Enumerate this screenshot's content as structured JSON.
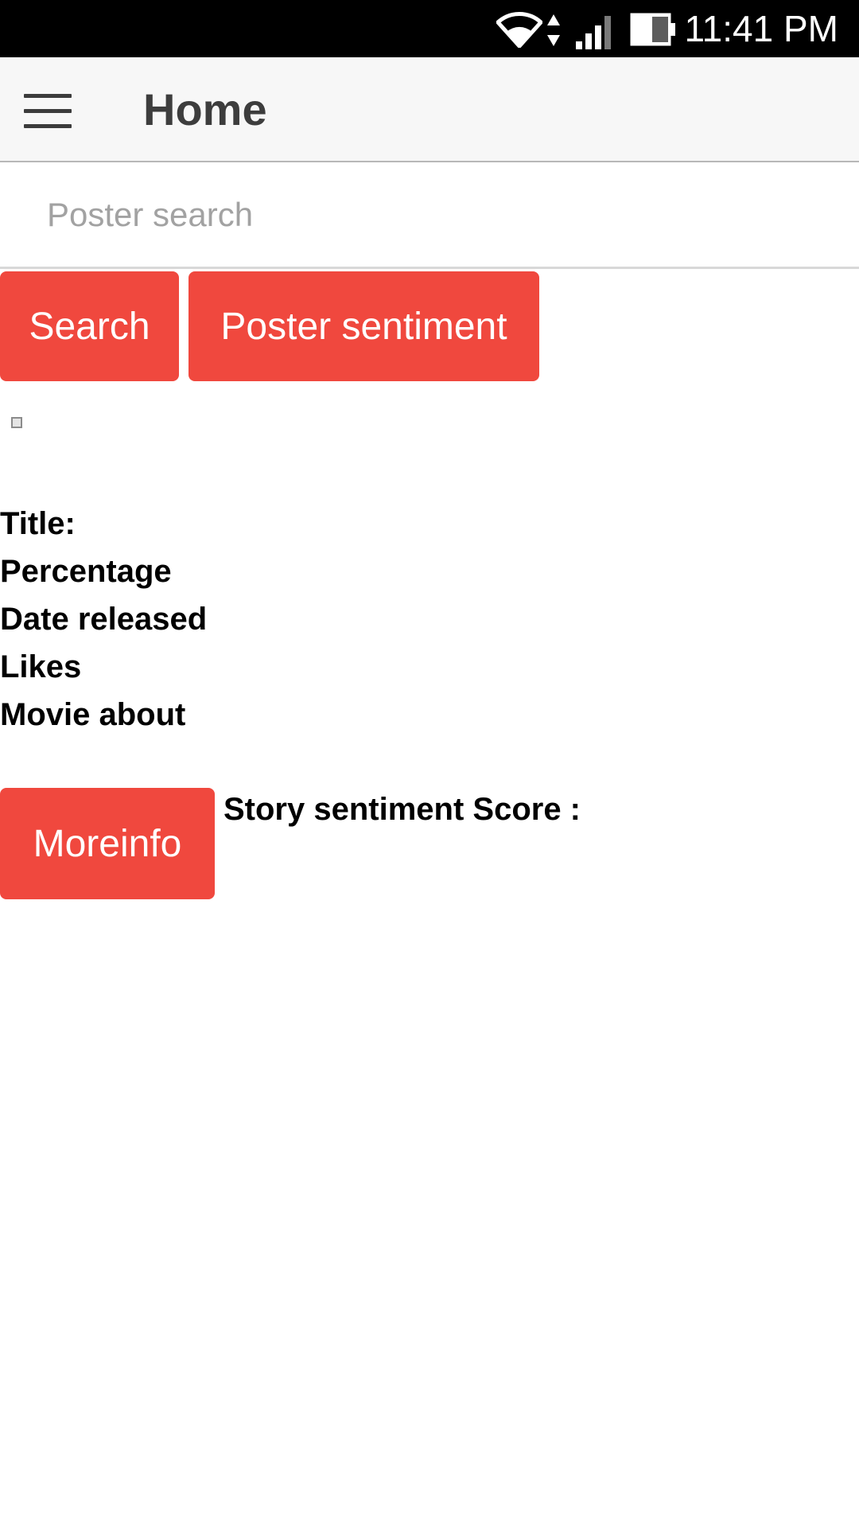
{
  "status_bar": {
    "time": "11:41 PM",
    "icons": [
      "wifi-icon",
      "data-arrows-icon",
      "signal-icon",
      "battery-icon"
    ]
  },
  "app_bar": {
    "title": "Home",
    "menu_icon": "hamburger-menu-icon"
  },
  "search": {
    "placeholder": "Poster search",
    "value": ""
  },
  "buttons": {
    "search": "Search",
    "poster_sentiment": "Poster sentiment",
    "moreinfo": "Moreinfo"
  },
  "poster_image": {
    "icon": "broken-image-icon"
  },
  "movie_info": {
    "title_label": "Title:",
    "percentage_label": "Percentage",
    "date_label": "Date released",
    "likes_label": "Likes",
    "about_label": "Movie about"
  },
  "story": {
    "score_label": "Story sentiment Score :"
  },
  "colors": {
    "accent": "#f0483e",
    "status_bar": "#000000",
    "app_bar": "#f7f7f7"
  }
}
